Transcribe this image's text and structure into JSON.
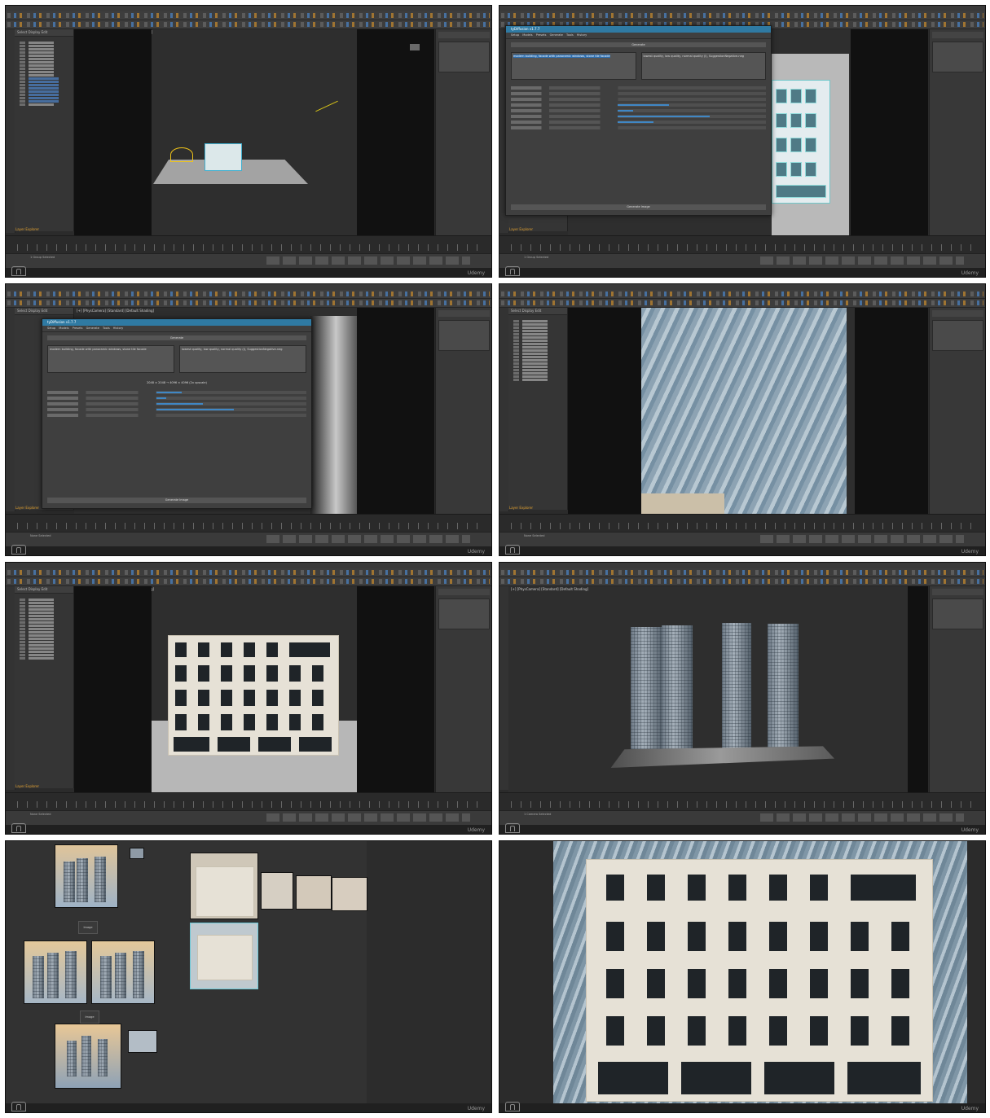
{
  "app": {
    "udemy_watermark": "Udemy",
    "layer_explorer_label": "Layer Explorer",
    "explorer_tabs": "Select  Display  Edit"
  },
  "panels": [
    {
      "id": "p1",
      "viewport_label": "[+] [Perspective] [Standard] [Default Shading]",
      "status": "1 Group Selected"
    },
    {
      "id": "p2",
      "viewport_label": "[+] [Perspective] [Standard] [Default Shading]",
      "status": "1 Group Selected"
    },
    {
      "id": "p3",
      "viewport_label": "[+] [PhysCamera] [Standard] [Default Shading]",
      "status": "None Selected"
    },
    {
      "id": "p4",
      "viewport_label": "[+] [PhysCamera] [Standard] [Default Shading]",
      "status": "None Selected"
    },
    {
      "id": "p5",
      "viewport_label": "[+] [PhysCamera] [Standard] [Default Shading]",
      "status": "None Selected"
    },
    {
      "id": "p6",
      "viewport_label": "[+] [PhysCamera] [Standard] [Default Shading]",
      "status": "1 Camera Selected"
    }
  ],
  "dialog1": {
    "title": "tyDiffusion v1.7.7",
    "tabs": "Setup  Models  Presets  Generate  Tools  History",
    "generate_label": "Generate",
    "prompt_text": "modern building, facade with panoramic windows, stone tile facade",
    "negative_text": "lowest quality, low quality, normal quality (I), SuggestionNegative-neg",
    "generate_button": "Generate Image"
  },
  "dialog2": {
    "title": "tyDiffusion v1.7.7",
    "tabs": "Setup  Models  Presets  Generate  Tools  History",
    "generate_label": "Generate",
    "prompt_text": "modern building, facade with panoramic windows, stone tile facade",
    "negative_text": "lowest quality, low quality, normal quality (I), SuggestionNegative-neg",
    "resolution": "2048 × 2048 → 4096 × 4096 (2x upscale)",
    "generate_button": "Generate Image"
  },
  "nodes": {
    "node1": "Image",
    "node2": "Image"
  }
}
